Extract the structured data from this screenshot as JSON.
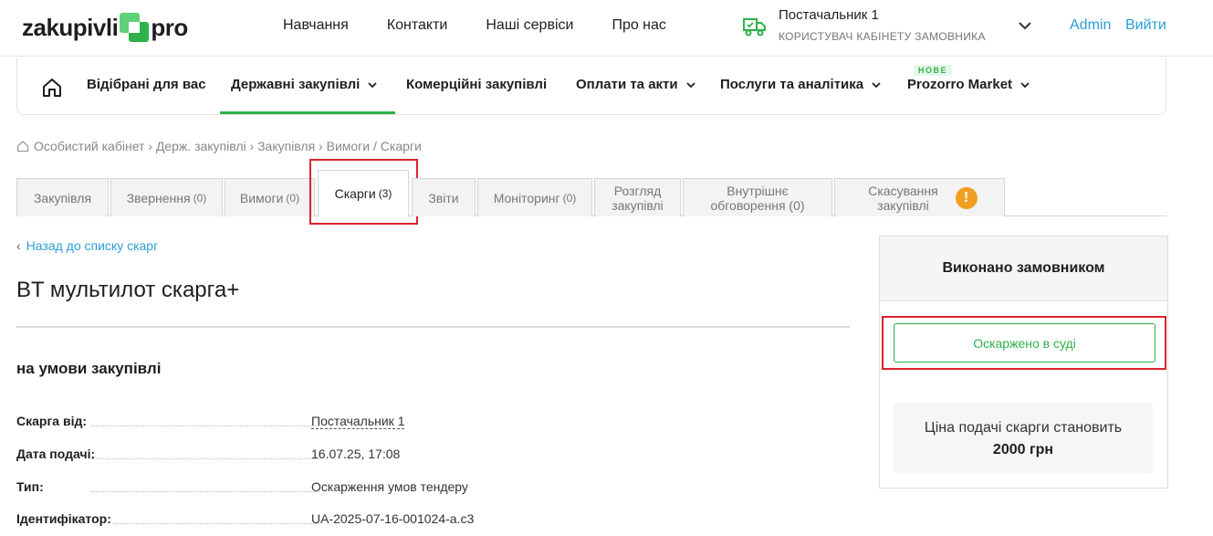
{
  "header": {
    "logo_left": "zakupivli",
    "logo_right": "pro",
    "nav": [
      "Навчання",
      "Контакти",
      "Наші сервіси",
      "Про нас"
    ],
    "user_name": "Постачальник 1",
    "user_role": "КОРИСТУВАЧ КАБІНЕТУ ЗАМОВНИКА",
    "admin": "Admin",
    "logout": "Вийти"
  },
  "mainnav": {
    "items": [
      "Відібрані для вас",
      "Державні закупівлі",
      "Комерційні закупівлі",
      "Оплати та акти",
      "Послуги та аналітика",
      "Prozorro Market"
    ],
    "new_badge": "НОВЕ"
  },
  "breadcrumb": "Особистий кабінет › Держ. закупівлі › Закупівля › Вимоги / Скарги",
  "tabs": [
    {
      "label": "Закупівля",
      "count": ""
    },
    {
      "label": "Звернення",
      "count": "(0)"
    },
    {
      "label": "Вимоги",
      "count": "(0)"
    },
    {
      "label": "Скарги",
      "count": "(3)"
    },
    {
      "label": "Звіти",
      "count": ""
    },
    {
      "label": "Моніторинг",
      "count": "(0)"
    },
    {
      "label": "Розгляд закупівлі",
      "count": ""
    },
    {
      "label": "Внутрішнє обговорення (0)",
      "count": ""
    },
    {
      "label": "Скасування закупівлі",
      "count": ""
    }
  ],
  "content": {
    "back": "Назад до списку скарг",
    "title": "BT мультилот скарга+",
    "subtitle": "на умови закупівлі",
    "rows": [
      {
        "label": "Скарга від:",
        "value": "Постачальник 1"
      },
      {
        "label": "Дата подачі:",
        "value": "16.07.25, 17:08"
      },
      {
        "label": "Тип:",
        "value": "Оскарження умов тендеру"
      },
      {
        "label": "Ідентифікатор:",
        "value": "UA-2025-07-16-001024-a.c3"
      }
    ]
  },
  "panel": {
    "header": "Виконано замовником",
    "status_button": "Оскаржено в суді",
    "price_text": "Ціна подачі скарги становить",
    "price_value": "2000 грн"
  },
  "colors": {
    "accent_green": "#2fb14b",
    "link_blue": "#2a9fd6",
    "highlight_red": "#d9232d",
    "warning": "#f0a020"
  }
}
